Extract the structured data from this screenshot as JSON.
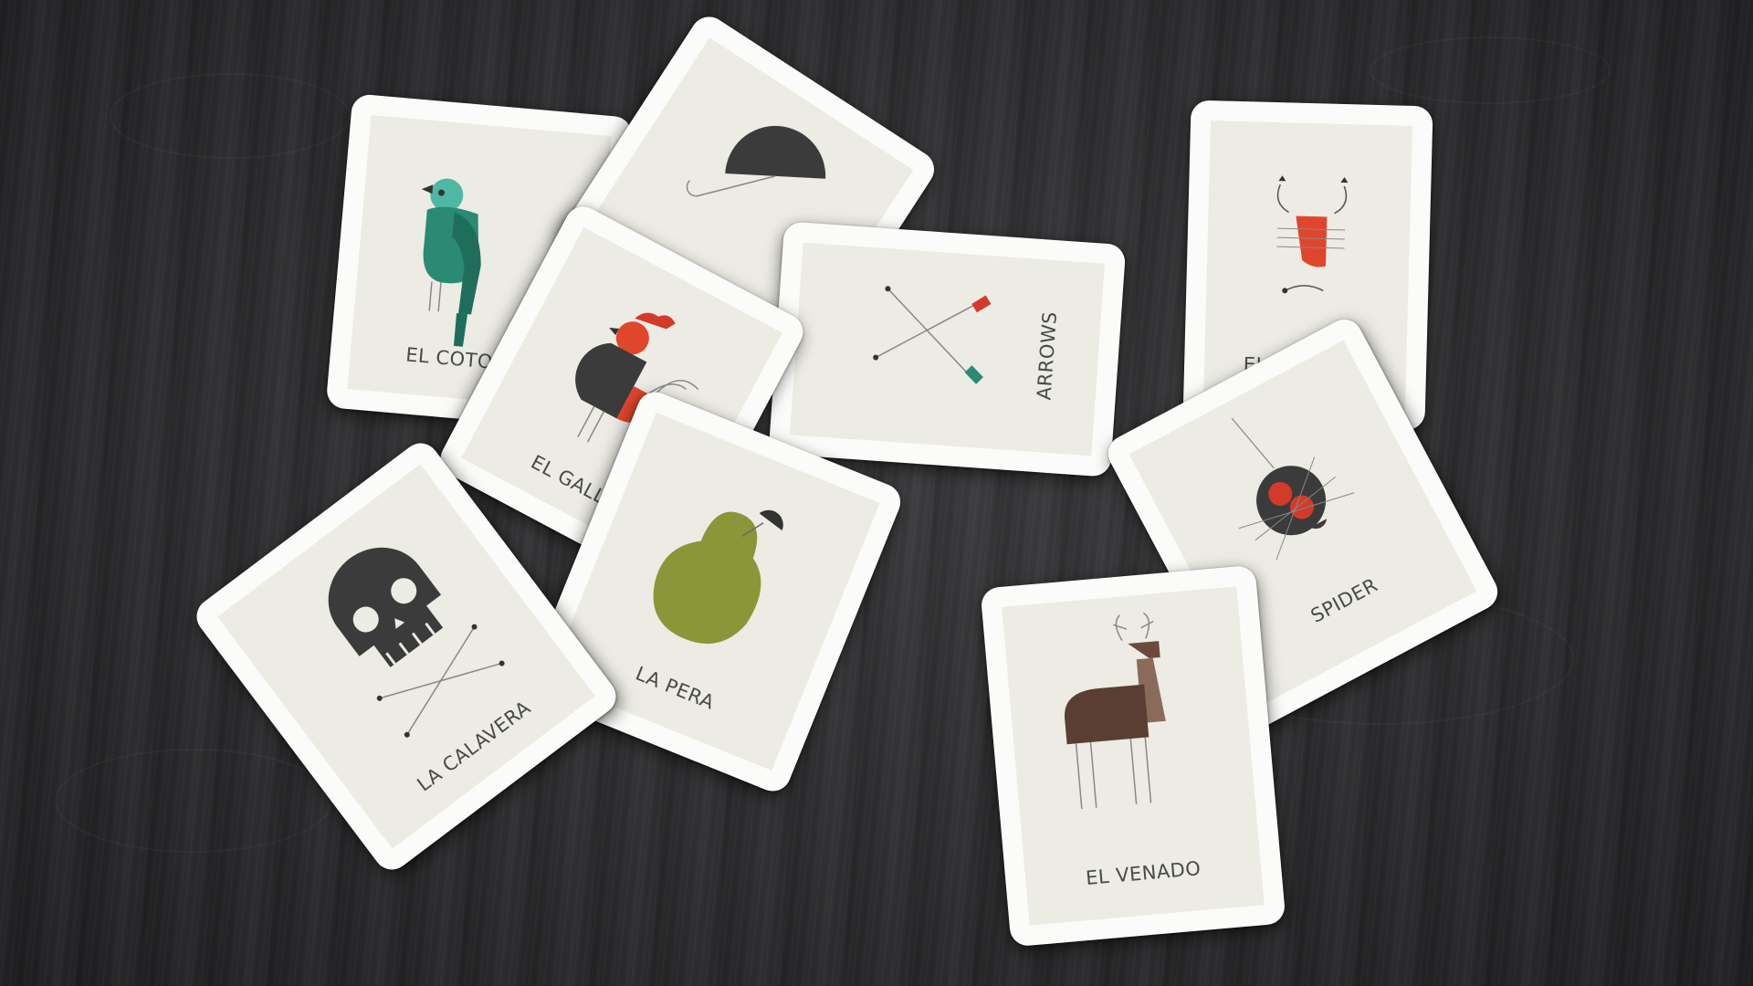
{
  "scene": "photo-of-loteria-cards-on-dark-wood",
  "colors": {
    "table": "#2c2c2e",
    "card_border": "#fbfbf9",
    "card_face": "#ecebe4",
    "label_text": "#4a4a48",
    "dark_gray": "#3b3b3b",
    "teal": "#2a8a74",
    "red": "#e0462c",
    "olive": "#8a9638",
    "brown": "#6b4a3c"
  },
  "cards": [
    {
      "label": "EL COTORRO",
      "icon": "parrot-icon"
    },
    {
      "label": "",
      "icon": "umbrella-icon"
    },
    {
      "label": "EL GALLO",
      "icon": "rooster-icon"
    },
    {
      "label": "ARROWS",
      "icon": "crossed-arrows-icon"
    },
    {
      "label": "EL ALACRAN",
      "icon": "scorpion-icon"
    },
    {
      "label": "SPIDER",
      "icon": "spider-icon"
    },
    {
      "label": "LA CALAVERA",
      "icon": "skull-icon"
    },
    {
      "label": "LA PERA",
      "icon": "pear-icon"
    },
    {
      "label": "EL VENADO",
      "icon": "deer-icon"
    }
  ]
}
